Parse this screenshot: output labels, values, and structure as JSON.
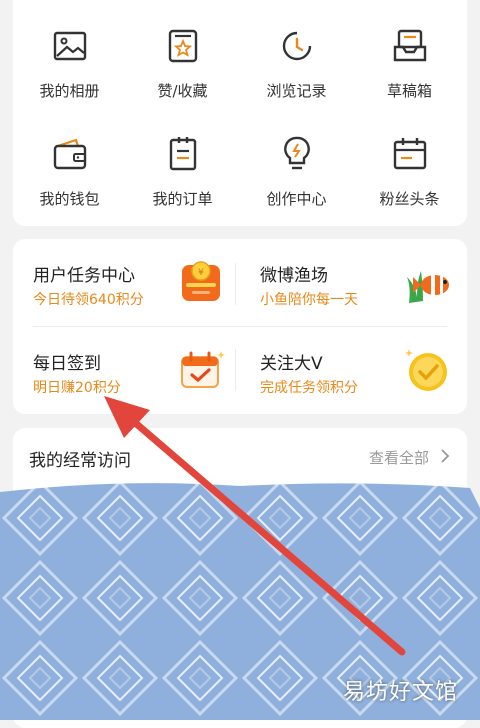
{
  "grid": {
    "items": [
      {
        "label": "我的相册",
        "icon": "photo-album-icon"
      },
      {
        "label": "赞/收藏",
        "icon": "favorite-star-icon"
      },
      {
        "label": "浏览记录",
        "icon": "history-clock-icon"
      },
      {
        "label": "草稿箱",
        "icon": "drafts-inbox-icon"
      },
      {
        "label": "我的钱包",
        "icon": "wallet-icon"
      },
      {
        "label": "我的订单",
        "icon": "order-list-icon"
      },
      {
        "label": "创作中心",
        "icon": "lightbulb-icon"
      },
      {
        "label": "粉丝头条",
        "icon": "calendar-icon"
      }
    ]
  },
  "tasks": {
    "user_task_center": {
      "title": "用户任务中心",
      "subtitle": "今日待领640积分",
      "icon": "coin-gift-icon"
    },
    "weibo_fishery": {
      "title": "微博渔场",
      "subtitle": "小鱼陪你每一天",
      "icon": "clownfish-icon"
    },
    "daily_checkin": {
      "title": "每日签到",
      "subtitle": "明日赚20积分",
      "icon": "checkin-calendar-icon"
    },
    "follow_big_v": {
      "title": "关注大V",
      "subtitle": "完成任务领积分",
      "icon": "gold-check-badge-icon"
    }
  },
  "visits": {
    "title": "我的经常访问",
    "view_all": "查看全部"
  },
  "watermark": "易坊好文馆",
  "colors": {
    "accent": "#e8891a",
    "arrow": "#e2453c",
    "scribble": "#8fb0dc",
    "icon_stroke": "#333333"
  }
}
